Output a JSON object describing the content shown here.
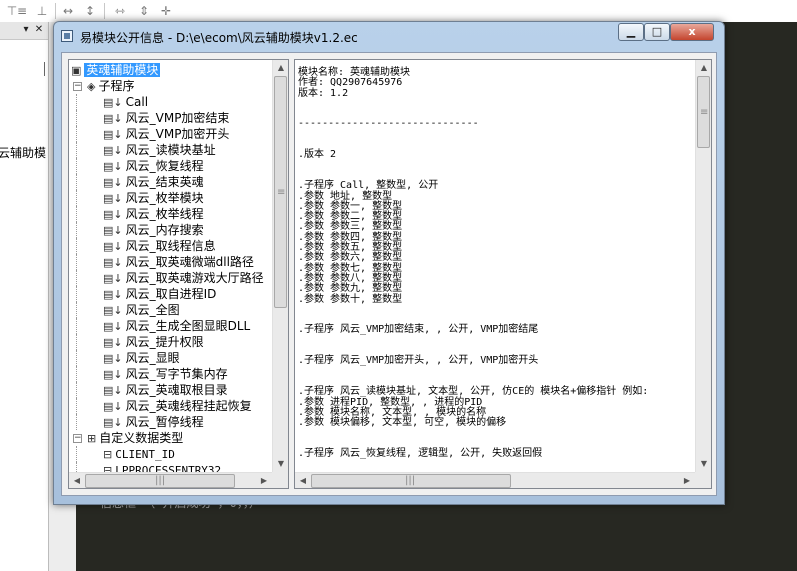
{
  "ide": {
    "left_panel_label": "云辅助模",
    "left_panel_dropdown_glyph": "▾",
    "left_panel_close_glyph": "✕",
    "code_snippet": "信息框 （“开启成功”，0，，）",
    "toolbar_icons": [
      "align-top-icon",
      "align-middle-icon",
      "align-bottom-icon",
      "space-horizontal-icon",
      "space-vertical-icon",
      "same-width-icon",
      "same-height-icon",
      "center-icon"
    ]
  },
  "dialog": {
    "title": "易模块公开信息 - D:\\e\\ecom\\风云辅助模块v1.2.ec",
    "minimize_glyph": "▁",
    "maximize_glyph": "□",
    "close_glyph": "x"
  },
  "tree": {
    "root": "英魂辅助模块",
    "subprograms_label": "子程序",
    "subprograms": [
      "Call",
      "风云_VMP加密结束",
      "风云_VMP加密开头",
      "风云_读模块基址",
      "风云_恢复线程",
      "风云_结束英魂",
      "风云_枚举模块",
      "风云_枚举线程",
      "风云_内存搜索",
      "风云_取线程信息",
      "风云_取英魂微端dll路径",
      "风云_取英魂游戏大厅路径",
      "风云_取自进程ID",
      "风云_全图",
      "风云_生成全图显眼DLL",
      "风云_提升权限",
      "风云_显眼",
      "风云_写字节集内存",
      "风云_英魂取根目录",
      "风云_英魂线程挂起恢复",
      "风云_暂停线程"
    ],
    "datatypes_label": "自定义数据类型",
    "datatypes": [
      "CLIENT_ID",
      "LPPROCESSENTRY32"
    ]
  },
  "info_text": "模块名称: 英魂辅助模块\n作者: QQ2907645976\n版本: 1.2\n\n\n------------------------------\n\n\n.版本 2\n\n\n.子程序 Call, 整数型, 公开\n.参数 地址, 整数型\n.参数 参数一, 整数型\n.参数 参数二, 整数型\n.参数 参数三, 整数型\n.参数 参数四, 整数型\n.参数 参数五, 整数型\n.参数 参数六, 整数型\n.参数 参数七, 整数型\n.参数 参数八, 整数型\n.参数 参数九, 整数型\n.参数 参数十, 整数型\n\n\n.子程序 风云_VMP加密结束, , 公开, VMP加密结尾\n\n\n.子程序 风云_VMP加密开头, , 公开, VMP加密开头\n\n\n.子程序 风云_读模块基址, 文本型, 公开, 仿CE的 模块名+偏移指针 例如:\n.参数 进程PID, 整数型, , 进程的PID\n.参数 模块名称, 文本型, , 模块的名称\n.参数 模块偏移, 文本型, 可空, 模块的偏移\n\n\n.子程序 风云_恢复线程, 逻辑型, 公开, 失败返回假"
}
